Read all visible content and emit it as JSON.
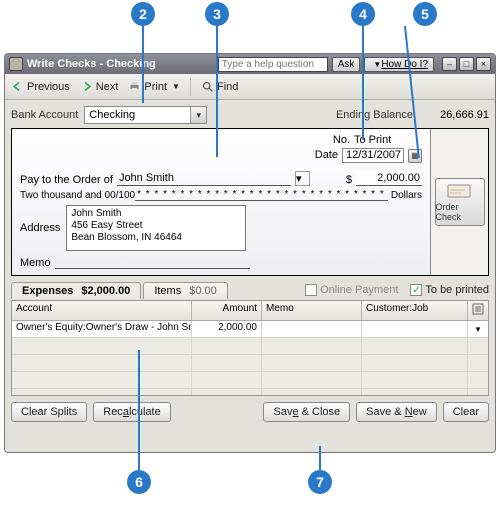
{
  "callouts": {
    "c2": "2",
    "c3": "3",
    "c4": "4",
    "c5": "5",
    "c6": "6",
    "c7": "7"
  },
  "titlebar": {
    "title": "Write Checks - Checking",
    "help_placeholder": "Type a help question",
    "ask": "Ask",
    "howdoi": "How Do I?"
  },
  "toolbar": {
    "previous": "Previous",
    "next": "Next",
    "print": "Print",
    "find": "Find"
  },
  "header": {
    "bank_account_label": "Bank Account",
    "bank_account_value": "Checking",
    "ending_balance_label": "Ending Balance",
    "ending_balance_value": "26,666.91"
  },
  "check": {
    "no_label": "No.",
    "no_value": "To Print",
    "date_label": "Date",
    "date_value": "12/31/2007",
    "pay_label": "Pay to the Order of",
    "payee": "John Smith",
    "amount_symbol": "$",
    "amount": "2,000.00",
    "amount_words": "Two thousand and 00/100",
    "stars": "* * * * * * * * * * * * * * * * * * * * * * * * * * * * * * *",
    "dollars": "Dollars",
    "address_label": "Address",
    "address_text": "John Smith\n456 Easy Street\nBean Blossom, IN 46464",
    "memo_label": "Memo",
    "order_check": "Order Check"
  },
  "tabs": {
    "expenses_label": "Expenses",
    "expenses_value": "$2,000.00",
    "items_label": "Items",
    "items_value": "$0.00",
    "online_payment": "Online Payment",
    "to_be_printed": "To be printed"
  },
  "grid": {
    "headers": {
      "account": "Account",
      "amount": "Amount",
      "memo": "Memo",
      "customer_job": "Customer:Job"
    },
    "rows": [
      {
        "account": "Owner's Equity:Owner's Draw - John Smith",
        "amount": "2,000.00",
        "memo": "",
        "customer_job": ""
      }
    ]
  },
  "buttons": {
    "clear_splits": "Clear Splits",
    "recalculate": "Recalculate",
    "save_close": "Save & Close",
    "save_new": "Save & New",
    "clear": "Clear"
  }
}
